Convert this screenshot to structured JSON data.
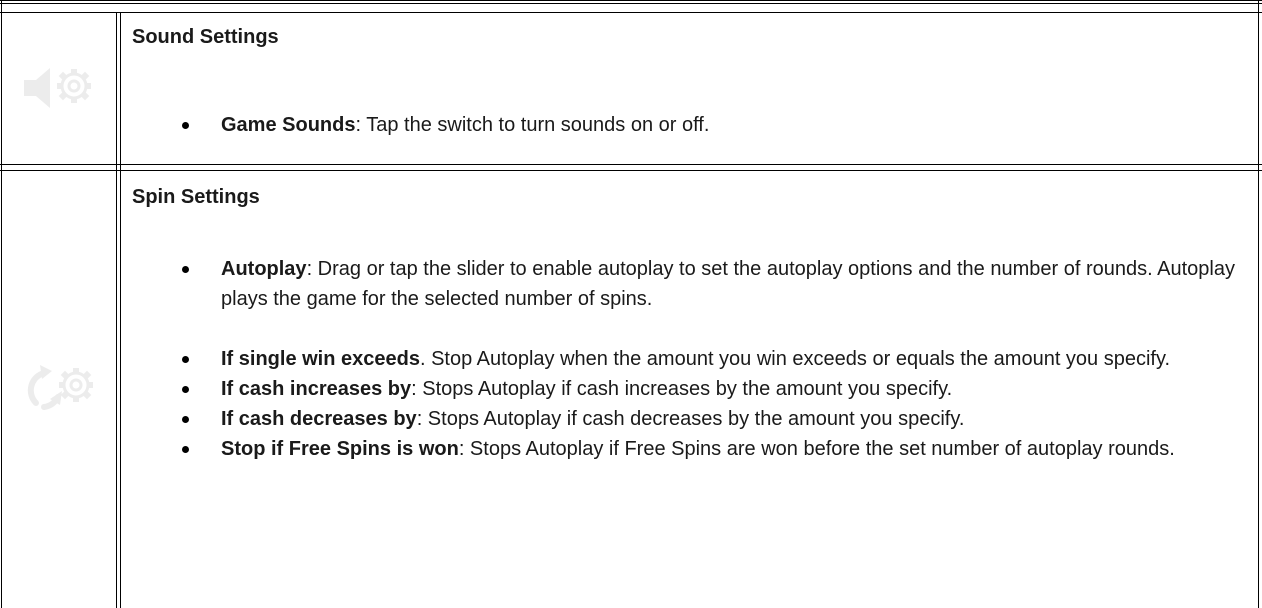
{
  "sections": {
    "sound": {
      "icon": "sound-settings-icon",
      "title": "Sound Settings",
      "items": [
        {
          "term": "Game Sounds",
          "text": ": Tap the switch to turn sounds on or off."
        }
      ]
    },
    "spin": {
      "icon": "spin-settings-icon",
      "title": "Spin Settings",
      "items": [
        {
          "term": "Autoplay",
          "text": ": Drag or tap the slider to enable autoplay to set the autoplay options and the number of rounds. Autoplay plays the game for the selected number of spins."
        },
        {
          "term": "If single win exceeds",
          "text": ". Stop Autoplay when the amount you win exceeds or equals the amount you specify."
        },
        {
          "term": "If cash increases by",
          "text": ": Stops Autoplay if cash increases by the amount you specify."
        },
        {
          "term": "If cash decreases by",
          "text": ": Stops Autoplay if cash decreases by the amount you specify."
        },
        {
          "term": "Stop if Free Spins is won",
          "text": ": Stops Autoplay if Free Spins are won before the set number of autoplay rounds."
        }
      ]
    }
  }
}
